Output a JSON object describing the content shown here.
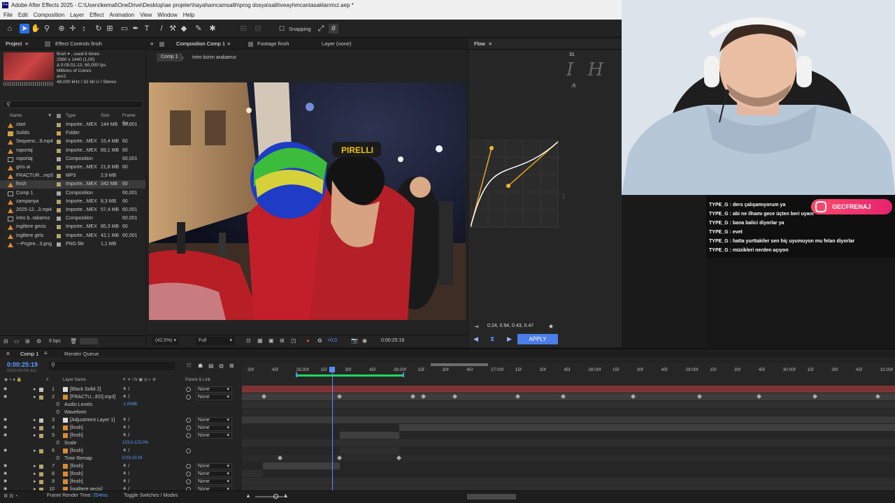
{
  "window": {
    "title": "Adobe After Effects 2025 - C:\\Users\\kemal\\OneDrive\\Desktop\\ae projeler\\hayahamcamsalih\\prog dosya\\salihveayhmcantasaklarımız.aep *",
    "menu": [
      "File",
      "Edit",
      "Composition",
      "Layer",
      "Effect",
      "Animation",
      "View",
      "Window",
      "Help"
    ]
  },
  "toolbar": {
    "snapping_label": "Snapping"
  },
  "project_panel": {
    "tab_project": "Project",
    "tab_effect_controls": "Effect Controls finsh",
    "footage_info": {
      "name": "finsh ▾ , used 6 times",
      "dims": "2560 x 1440 (1,00)",
      "duration": "Δ 0:05:51:13, 60,000 fps",
      "colors": "Millions of Colors",
      "codec": "avc1",
      "audio": "48,000 kHz / 32 bit U / Stereo"
    },
    "columns": {
      "name": "Name",
      "type": "Type",
      "size": "Size",
      "frame_rate": "Frame Ra..."
    },
    "rows": [
      {
        "name": "start",
        "type": "Importe...MEX",
        "size": "144 MB",
        "fr": "60,001",
        "color": "#b3a56a",
        "icon": "footage"
      },
      {
        "name": "Solids",
        "type": "Folder",
        "size": "",
        "fr": "",
        "color": "#c9a34b",
        "icon": "folder"
      },
      {
        "name": "Sequenc...9.mp4",
        "type": "Importe...MEX",
        "size": "15,4 MB",
        "fr": "60",
        "color": "#b3a56a",
        "icon": "footage"
      },
      {
        "name": "roportaj",
        "type": "Importe...MEX",
        "size": "89,1 MB",
        "fr": "60",
        "color": "#b3a56a",
        "icon": "footage"
      },
      {
        "name": "roportaj",
        "type": "Composition",
        "size": "",
        "fr": "60,001",
        "color": "#a7a7a7",
        "icon": "comp"
      },
      {
        "name": "giris ai",
        "type": "Importe...MEX",
        "size": "21,8 MB",
        "fr": "60",
        "color": "#b3a56a",
        "icon": "footage"
      },
      {
        "name": "FRACTUR...mp3",
        "type": "MP3",
        "size": "2,9 MB",
        "fr": "",
        "color": "#b3a56a",
        "icon": "audio"
      },
      {
        "name": "finsh",
        "type": "Importe...MEX",
        "size": "342 MB",
        "fr": "60",
        "color": "#b3a56a",
        "icon": "footage",
        "selected": true
      },
      {
        "name": "Comp 1",
        "type": "Composition",
        "size": "",
        "fr": "60,001",
        "color": "#a7a7a7",
        "icon": "comp"
      },
      {
        "name": "zampanya",
        "type": "Importe...MEX",
        "size": "8,3 MB",
        "fr": "60",
        "color": "#b3a56a",
        "icon": "footage"
      },
      {
        "name": "2025-12...3.mp4",
        "type": "Importe...MEX",
        "size": "57,4 MB",
        "fr": "60,001",
        "color": "#b3a56a",
        "icon": "footage"
      },
      {
        "name": "intro b..rabamız",
        "type": "Composition",
        "size": "",
        "fr": "60,001",
        "color": "#a7a7a7",
        "icon": "comp"
      },
      {
        "name": "ingiltere gecis",
        "type": "Importe...MEX",
        "size": "85,3 MB",
        "fr": "60",
        "color": "#b3a56a",
        "icon": "footage"
      },
      {
        "name": "ingiltere giris",
        "type": "Importe...MEX",
        "size": "42,1 MB",
        "fr": "60,001",
        "color": "#b3a56a",
        "icon": "footage"
      },
      {
        "name": "---Pngtre...3.png",
        "type": "PNG file",
        "size": "1,1 MB",
        "fr": "",
        "color": "#a7a7a7",
        "icon": "image"
      }
    ],
    "bpc": "8 bpc"
  },
  "comp_panel": {
    "tab_composition": "Composition Comp 1",
    "tab_footage": "Footage finsh",
    "tab_layer": "Layer (none)",
    "breadcrumb_1": "Comp 1",
    "breadcrumb_2": "intro bizim arabamız",
    "zoom": "(42,5%)",
    "resolution": "Full",
    "exposure": "+0,0",
    "timecode": "0:00:25:19"
  },
  "flow_panel": {
    "tab": "Flow",
    "frame_num": "31",
    "curve_values": "0.24, 0.94, 0.43, 0.47",
    "apply_label": "APPLY"
  },
  "chat": {
    "instagram_handle": "GECFRENAJ",
    "lines": [
      {
        "user": "TYPE_G",
        "msg": "ders çalışamıyorum ya"
      },
      {
        "user": "TYPE_G",
        "msg": "abi ne ilhamı gece üçten beri uyanı"
      },
      {
        "user": "TYPE_G",
        "msg": "bana balici diyorlar ya"
      },
      {
        "user": "TYPE_G",
        "msg": "evet"
      },
      {
        "user": "TYPE_G",
        "msg": "hatta yurttakiler sen hiç uyumuyon mu felan diyorlar"
      },
      {
        "user": "TYPE_G",
        "msg": "müzikleri nerden açıyon"
      }
    ]
  },
  "timeline": {
    "tab_comp": "Comp 1",
    "tab_render": "Render Queue",
    "timecode": "0:00:25:19",
    "timecode_sub": "01519 (60.001 fps)",
    "col_layer_name": "Layer Name",
    "col_parent": "Parent & Link",
    "ruler": [
      "30f",
      "45f",
      "25:00f",
      "15f",
      "30f",
      "45f",
      "26:00f",
      "15f",
      "30f",
      "45f",
      "27:00f",
      "15f",
      "30f",
      "45f",
      "28:00f",
      "15f",
      "30f",
      "45f",
      "29:00f",
      "15f",
      "30f",
      "45f",
      "30:00f",
      "15f",
      "30f",
      "45f",
      "31:00f"
    ],
    "layers": [
      {
        "num": "1",
        "name": "[Black Solid 2]",
        "parent": "None",
        "color": "#c4c4c4"
      },
      {
        "num": "2",
        "name": "[FRACTU...ED].mp3]",
        "parent": "None",
        "color": "#b3a56a"
      },
      {
        "sub": "Audio Levels",
        "value": "-1,00dB"
      },
      {
        "sub": "Waveform"
      },
      {
        "num": "3",
        "name": "[Adjustment Layer 1]",
        "parent": "None",
        "color": "#c4c4c4"
      },
      {
        "num": "4",
        "name": "[finsh]",
        "parent": "None",
        "color": "#b3a56a"
      },
      {
        "num": "5",
        "name": "[finsh]",
        "parent": "None",
        "color": "#b3a56a"
      },
      {
        "sub": "Scale",
        "value": "123,0,123,0%"
      },
      {
        "num": "6",
        "name": "[finsh]",
        "parent": "",
        "color": "#b3a56a"
      },
      {
        "sub": "Time Remap",
        "value": "0:03:10:24"
      },
      {
        "num": "7",
        "name": "[finsh]",
        "parent": "None",
        "color": "#b3a56a"
      },
      {
        "num": "8",
        "name": "[finsh]",
        "parent": "None",
        "color": "#b3a56a"
      },
      {
        "num": "9",
        "name": "[finsh]",
        "parent": "None",
        "color": "#b3a56a"
      },
      {
        "num": "10",
        "name": "[ingiltere gecis]",
        "parent": "None",
        "color": "#b3a56a"
      }
    ],
    "frame_render_label": "Frame Render Time:",
    "frame_render_value": "254ms",
    "toggle_label": "Toggle Switches / Modes"
  }
}
